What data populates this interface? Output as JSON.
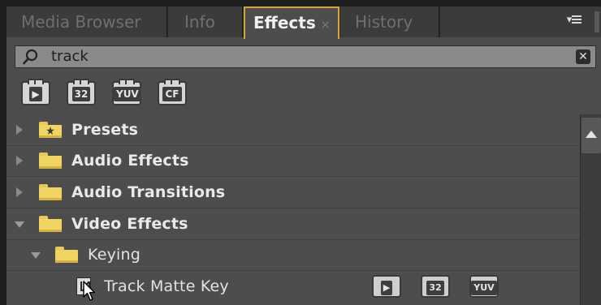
{
  "tabs": [
    {
      "label": "Media Browser"
    },
    {
      "label": "Info"
    },
    {
      "label": "Effects",
      "close": "×",
      "active": true
    },
    {
      "label": "History"
    }
  ],
  "search": {
    "value": "track"
  },
  "filter_badges": [
    "32",
    "YUV",
    "CF"
  ],
  "tree": {
    "presets": "Presets",
    "audio_effects": "Audio Effects",
    "audio_transitions": "Audio Transitions",
    "video_effects": "Video Effects",
    "keying": "Keying",
    "track_matte_key": "Track Matte Key"
  },
  "row_badges": [
    "32",
    "YUV"
  ],
  "colors": {
    "accent": "#d8a23a",
    "folder": "#f2d463"
  }
}
